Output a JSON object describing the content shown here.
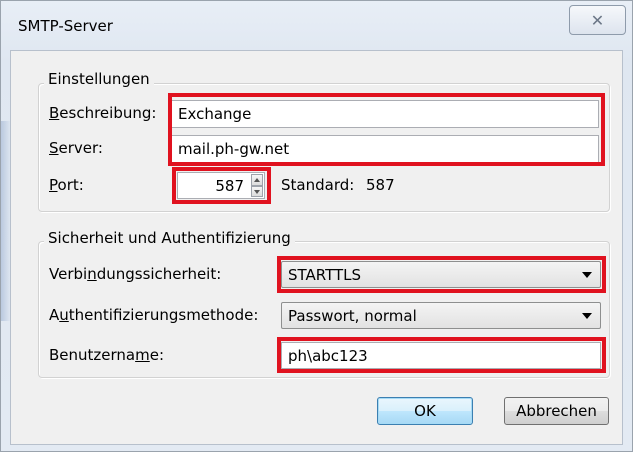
{
  "window": {
    "title": "SMTP-Server",
    "close_glyph": "✕"
  },
  "settings": {
    "group_label": "Einstellungen",
    "description": {
      "label_underline": "B",
      "label_rest": "eschreibung:",
      "value": "Exchange"
    },
    "server": {
      "label_underline": "S",
      "label_rest": "erver:",
      "value": "mail.ph-gw.net"
    },
    "port": {
      "label_underline": "P",
      "label_rest": "ort:",
      "value": "587",
      "default_label": "Standard:",
      "default_value": "587"
    }
  },
  "security": {
    "group_label": "Sicherheit und Authentifizierung",
    "connection": {
      "label_pre": "Verbi",
      "label_underline": "n",
      "label_post": "dungssicherheit:",
      "value": "STARTTLS"
    },
    "auth_method": {
      "label_pre": "A",
      "label_underline": "u",
      "label_post": "thentifizierungsmethode:",
      "value": "Passwort, normal"
    },
    "username": {
      "label_pre": "Benutzerna",
      "label_underline": "m",
      "label_post": "e:",
      "value": "ph\\abc123"
    }
  },
  "buttons": {
    "ok": "OK",
    "cancel": "Abbrechen"
  },
  "colors": {
    "highlight": "#e0121f"
  }
}
